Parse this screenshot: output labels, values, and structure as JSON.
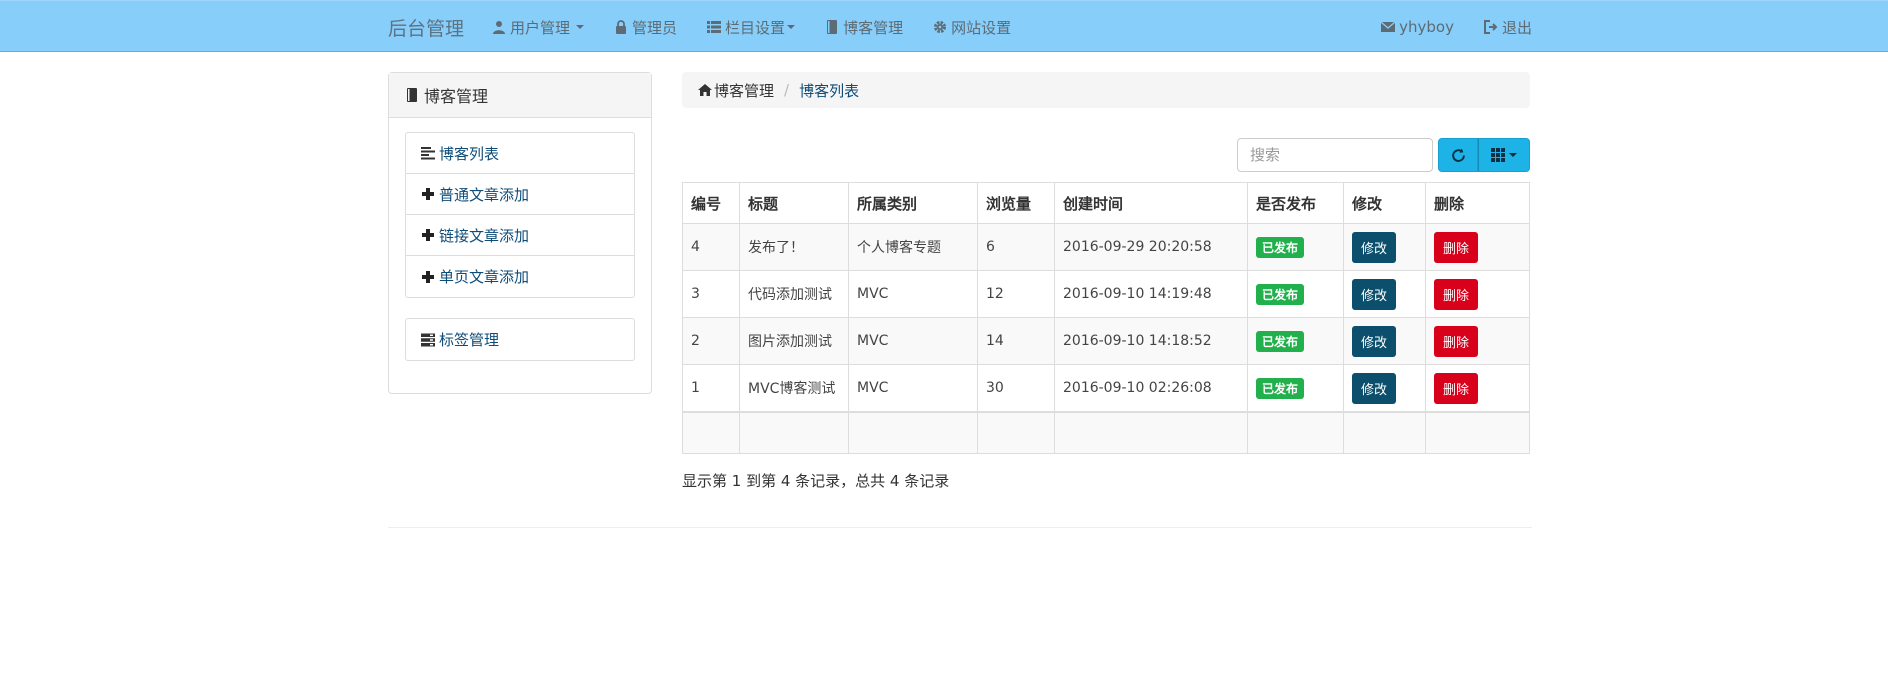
{
  "navbar": {
    "brand": "后台管理",
    "items": [
      {
        "label": "用户管理",
        "icon": "user-icon",
        "dropdown": true
      },
      {
        "label": "管理员",
        "icon": "lock-icon",
        "dropdown": false
      },
      {
        "label": "栏目设置",
        "icon": "list-icon",
        "dropdown": true
      },
      {
        "label": "博客管理",
        "icon": "book-icon",
        "dropdown": false
      },
      {
        "label": "网站设置",
        "icon": "gear-icon",
        "dropdown": false
      }
    ],
    "user": "yhyboy",
    "logout": "退出"
  },
  "sidebar": {
    "title": "博客管理",
    "items": [
      {
        "label": "博客列表",
        "icon": "align-left-icon"
      },
      {
        "label": "普通文章添加",
        "icon": "plus-icon"
      },
      {
        "label": "链接文章添加",
        "icon": "plus-icon"
      },
      {
        "label": "单页文章添加",
        "icon": "plus-icon"
      }
    ],
    "tag_item": {
      "label": "标签管理",
      "icon": "tasks-icon"
    }
  },
  "breadcrumb": {
    "home": "博客管理",
    "current": "博客列表"
  },
  "toolbar": {
    "search_placeholder": "搜索"
  },
  "table": {
    "headers": [
      "编号",
      "标题",
      "所属类别",
      "浏览量",
      "创建时间",
      "是否发布",
      "修改",
      "删除"
    ],
    "rows": [
      {
        "id": "4",
        "title": "发布了！",
        "category": "个人博客专题",
        "views": "6",
        "created": "2016-09-29 20:20:58",
        "status": "已发布",
        "edit": "修改",
        "delete": "删除"
      },
      {
        "id": "3",
        "title": "代码添加测试",
        "category": "MVC",
        "views": "12",
        "created": "2016-09-10 14:19:48",
        "status": "已发布",
        "edit": "修改",
        "delete": "删除"
      },
      {
        "id": "2",
        "title": "图片添加测试",
        "category": "MVC",
        "views": "14",
        "created": "2016-09-10 14:18:52",
        "status": "已发布",
        "edit": "修改",
        "delete": "删除"
      },
      {
        "id": "1",
        "title": "MVC博客测试",
        "category": "MVC",
        "views": "30",
        "created": "2016-09-10 02:26:08",
        "status": "已发布",
        "edit": "修改",
        "delete": "删除"
      }
    ]
  },
  "summary": "显示第 1 到第 4 条记录，总共 4 条记录",
  "colors": {
    "navbar_bg": "#87cefa",
    "published": "#21b04b",
    "edit": "#0b4f6c",
    "delete": "#d9001b",
    "toolbar_btn": "#1eb3e6"
  }
}
